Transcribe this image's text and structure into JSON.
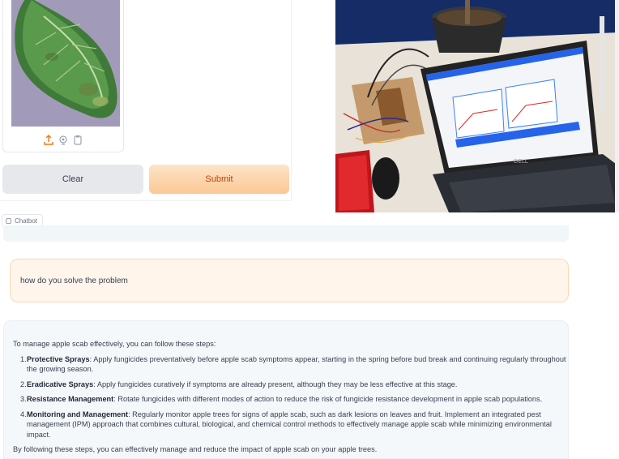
{
  "upload_panel": {
    "icons": [
      "upload-icon",
      "webcam-icon",
      "clipboard-icon"
    ],
    "clear_label": "Clear",
    "submit_label": "Submit"
  },
  "chatbot": {
    "label": "Chatbot",
    "user_message": "how do you solve the problem",
    "bot_message": {
      "intro": "To manage apple scab effectively, you can follow these steps:",
      "steps": [
        {
          "num": "1.",
          "title": "Protective Sprays",
          "text": ": Apply fungicides preventatively before apple scab symptoms appear, starting in the spring before bud break and continuing regularly throughout the growing season."
        },
        {
          "num": "2.",
          "title": "Eradicative Sprays",
          "text": ": Apply fungicides curatively if symptoms are already present, although they may be less effective at this stage."
        },
        {
          "num": "3.",
          "title": "Resistance Management",
          "text": ": Rotate fungicides with different modes of action to reduce the risk of fungicide resistance development in apple scab populations."
        },
        {
          "num": "4.",
          "title": "Monitoring and Management",
          "text": ": Regularly monitor apple trees for signs of apple scab, such as dark lesions on leaves and fruit. Implement an integrated pest management (IPM) approach that combines cultural, biological, and chemical control methods to effectively manage apple scab while minimizing environmental impact."
        }
      ],
      "outro": "By following these steps, you can effectively manage and reduce the impact of apple scab on your apple trees."
    }
  },
  "colors": {
    "submit_bg": "#fbc894",
    "submit_text": "#c2410c",
    "user_bubble_bg": "#fff5eb",
    "bot_bubble_bg": "#f5f8fa"
  }
}
